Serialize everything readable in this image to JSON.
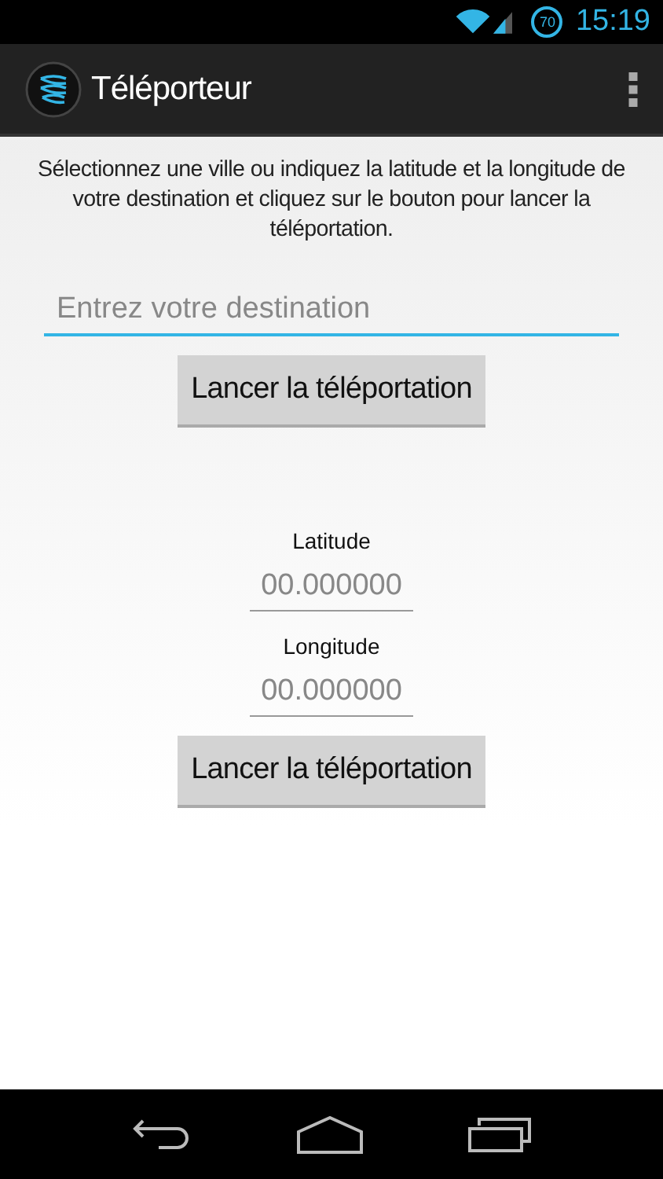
{
  "status_bar": {
    "battery": "70",
    "time": "15:19"
  },
  "action_bar": {
    "title": "Téléporteur"
  },
  "instructions": "Sélectionnez une ville ou indiquez la latitude et la longitude de votre destination et cliquez sur le bouton pour lancer la téléportation.",
  "destination_field": {
    "placeholder": "Entrez votre destination",
    "focused": true
  },
  "destination_button": "Lancer la téléportation",
  "coordinates": [
    {
      "label": "Latitude",
      "placeholder": "00.000000",
      "focused": false
    },
    {
      "label": "Longitude",
      "placeholder": "00.000000",
      "focused": false
    }
  ],
  "coordinates_button": "Lancer la téléportation"
}
